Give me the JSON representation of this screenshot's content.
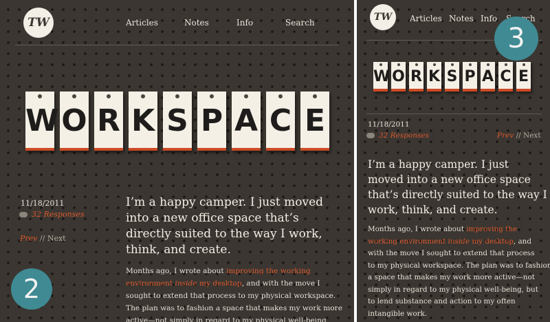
{
  "logo": {
    "text": "TW"
  },
  "nav": {
    "items": [
      "Articles",
      "Notes",
      "Info",
      "Search"
    ]
  },
  "banner": {
    "letters": [
      "W",
      "O",
      "R",
      "K",
      "S",
      "P",
      "A",
      "C",
      "E"
    ]
  },
  "post": {
    "date": "11/18/2011",
    "responses": "32 Responses",
    "prev": "Prev",
    "separator": "//",
    "next": "Next",
    "headline_left": [
      "I’m a happy camper. I just moved",
      "into a new office space that’s",
      "directly suited to the way I work,",
      "think, and create."
    ],
    "headline_right": [
      "I’m a happy camper. I just",
      "moved into a new office space",
      "that’s directly suited to the way I",
      "work, think, and create."
    ],
    "body_left": [
      {
        "text": "Months ago, I wrote about ",
        "link": "improving the working"
      },
      {
        "text": "",
        "link": "environment",
        "italic_link": "inside",
        "link2": "my desktop",
        "after": ", and with the move I"
      },
      {
        "text": "sought to extend that process to my physical workspace."
      },
      {
        "text": "The plan was to fashion a space that makes my work more"
      },
      {
        "text": "active—not simply in regard to my physical well-being,"
      }
    ],
    "body_right": [
      {
        "text": "Months ago, I wrote about ",
        "link": "improving the"
      },
      {
        "text": "",
        "link": "working environment",
        "italic_link": "inside",
        "link2": "my desktop",
        "after": ", and"
      },
      {
        "text": "with the move I sought to extend that process"
      },
      {
        "text": "to my physical workspace. The plan was to fashion"
      },
      {
        "text": "a space that makes my work more active—not"
      },
      {
        "text": "simply in regard to my physical well-being, but"
      },
      {
        "text": "to lend substance and action to my often"
      },
      {
        "text": "intangible work."
      }
    ]
  },
  "badges": {
    "left": "2",
    "right": "3"
  },
  "colors": {
    "background": "#3b3631",
    "accent": "#d9592f",
    "badge": "#3f8a93",
    "tile": "#f4f0e6"
  }
}
